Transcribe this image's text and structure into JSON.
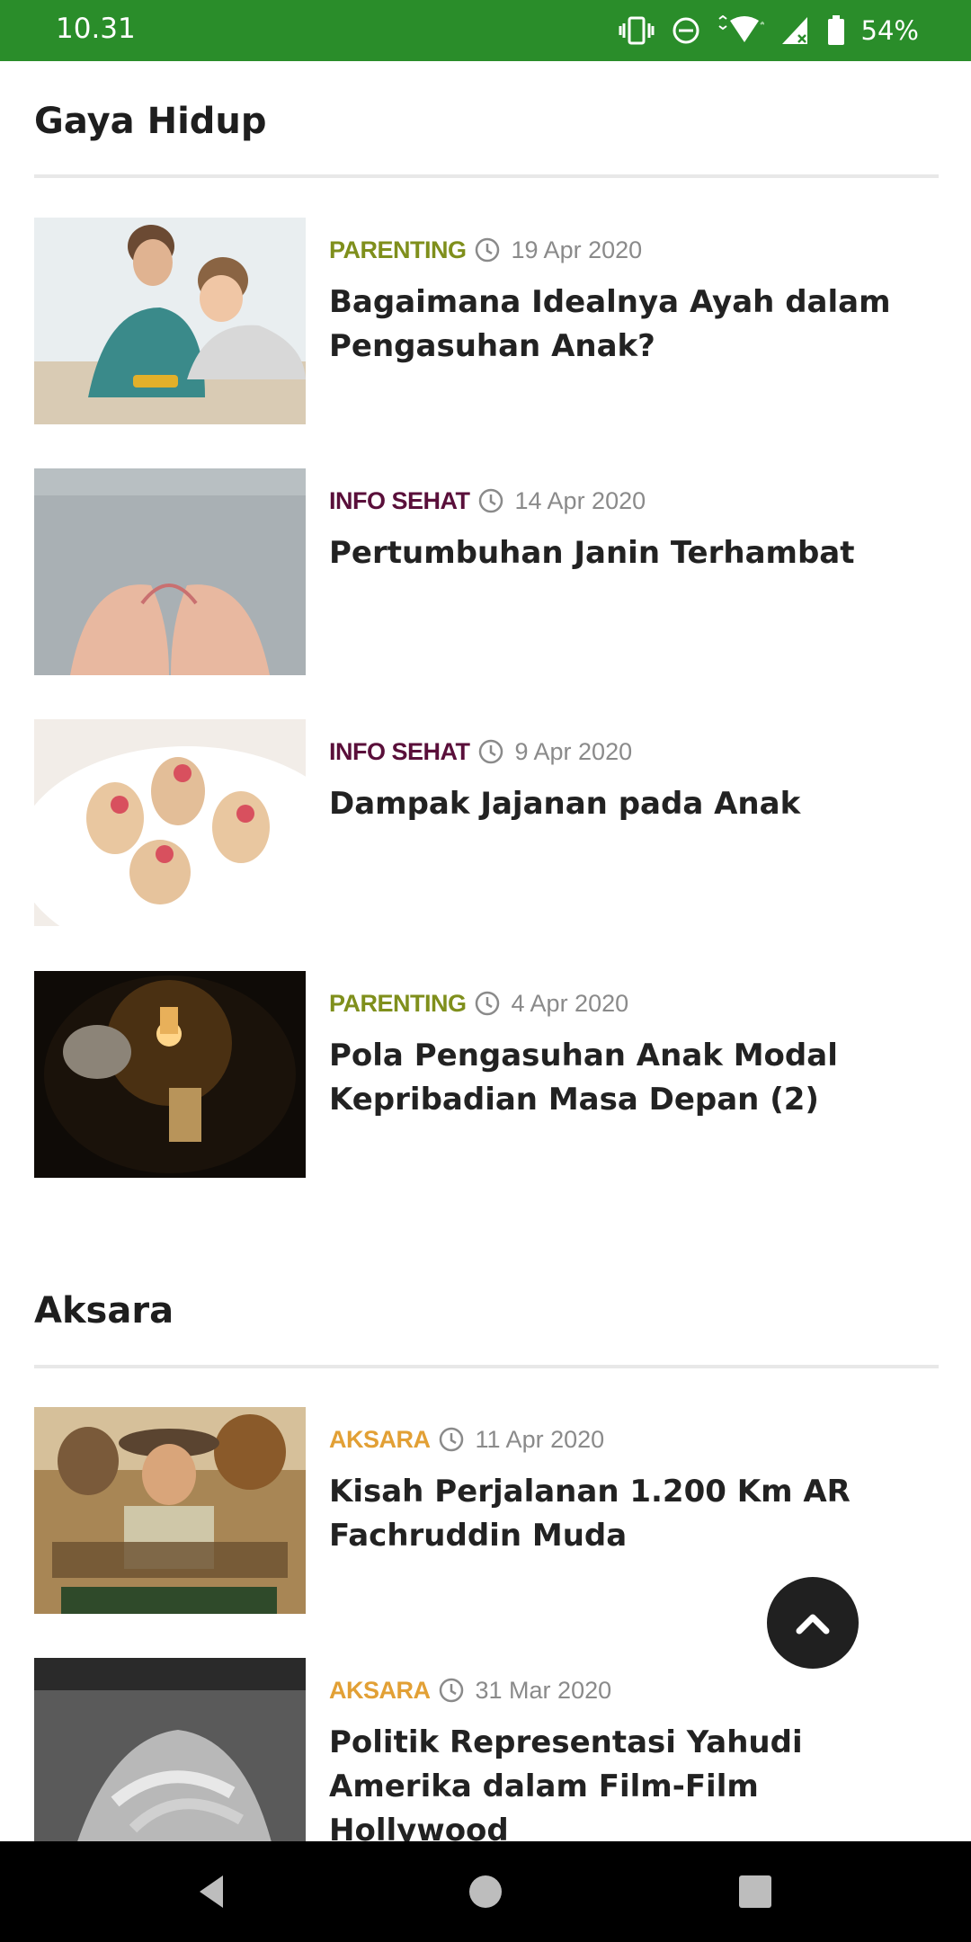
{
  "status_bar": {
    "time": "10.31",
    "battery": "54%"
  },
  "sections": [
    {
      "title": "Gaya Hidup",
      "articles": [
        {
          "category": "PARENTING",
          "category_color": "#7f8f1c",
          "date": "19 Apr 2020",
          "title": "Bagaimana Idealnya Ayah dalam Pengasuhan Anak?",
          "image": "father-son-playing-photo"
        },
        {
          "category": "INFO SEHAT",
          "category_color": "#5a0f3a",
          "date": "14 Apr 2020",
          "title": "Pertumbuhan Janin Terhambat",
          "image": "pregnant-belly-heart-hands-photo"
        },
        {
          "category": "INFO SEHAT",
          "category_color": "#5a0f3a",
          "date": "9 Apr 2020",
          "title": "Dampak Jajanan pada Anak",
          "image": "snack-plate-photo"
        },
        {
          "category": "PARENTING",
          "category_color": "#7f8f1c",
          "date": "4 Apr 2020",
          "title": "Pola Pengasuhan Anak Modal Kepribadian Masa Depan (2)",
          "image": "candlelight-study-photo"
        }
      ]
    },
    {
      "title": "Aksara",
      "articles": [
        {
          "category": "AKSARA",
          "category_color": "#e2a035",
          "date": "11 Apr 2020",
          "title": "Kisah Perjalanan 1.200 Km AR Fachruddin Muda",
          "image": "meniti-movie-poster"
        },
        {
          "category": "AKSARA",
          "category_color": "#e2a035",
          "date": "31 Mar 2020",
          "title": "Politik Representasi Yahudi Amerika dalam Film-Film Hollywood",
          "image": "schindlers-list-poster"
        }
      ]
    }
  ],
  "icons": {
    "clock": "clock-icon",
    "scroll_top": "chevron-up-icon",
    "nav_back": "back-triangle-icon",
    "nav_home": "home-circle-icon",
    "nav_recents": "recents-square-icon"
  },
  "colors": {
    "status_bar": "#2a8d2a",
    "scroll_button": "#202020"
  }
}
